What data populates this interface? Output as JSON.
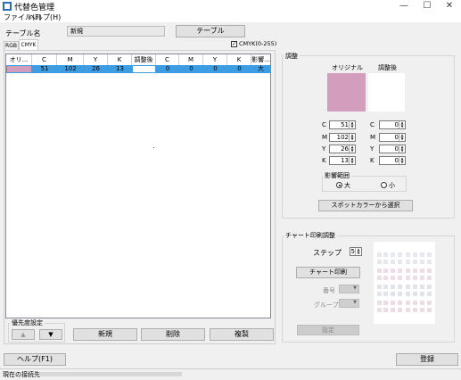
{
  "window": {
    "title": "代替色管理"
  },
  "menu": {
    "file": "ファイル(F)",
    "help": "ヘルプ(H)"
  },
  "header": {
    "table_name_label": "テーブル名",
    "table_name_value": "新規",
    "table_button": "テーブル"
  },
  "tabs": [
    "RGB",
    "CMYK"
  ],
  "cmyk_range_label": "CMYK(0-255)",
  "table": {
    "columns": [
      "オリ...",
      "C",
      "M",
      "Y",
      "K",
      "調整後",
      "C",
      "M",
      "Y",
      "K",
      "影響..."
    ],
    "rows": [
      {
        "c1": "51",
        "m1": "102",
        "y1": "26",
        "k1": "13",
        "c2": "0",
        "m2": "0",
        "y2": "0",
        "k2": "0",
        "range": "大"
      }
    ],
    "original_swatch": "#d39ebd",
    "selected_row_color": "#3d9de2"
  },
  "priority": {
    "label": "優先度設定",
    "up": "▲",
    "down": "▼"
  },
  "actions": {
    "new": "新規",
    "delete": "削除",
    "copy": "複製"
  },
  "adjust": {
    "title": "調整",
    "original_label": "オリジナル",
    "adjusted_label": "調整後",
    "original_color": "#d39ebd",
    "adjusted_color": "#ffffff",
    "left": [
      {
        "label": "C",
        "value": "51"
      },
      {
        "label": "M",
        "value": "102"
      },
      {
        "label": "Y",
        "value": "26"
      },
      {
        "label": "K",
        "value": "13"
      }
    ],
    "right": [
      {
        "label": "C",
        "value": "0"
      },
      {
        "label": "M",
        "value": "0"
      },
      {
        "label": "Y",
        "value": "0"
      },
      {
        "label": "K",
        "value": "0"
      }
    ],
    "range_title": "影響範囲",
    "range_large": "大",
    "range_small": "小",
    "spot_button": "スポットカラーから選択"
  },
  "chart": {
    "title": "チャート印刷調整",
    "step_label": "ステップ",
    "step_value": "5",
    "print_button": "チャート印刷",
    "number_label": "番号",
    "group_label": "グループ",
    "set_button": "設定"
  },
  "footer": {
    "help_button": "ヘルプ(F1)",
    "register_button": "登録"
  },
  "status": {
    "current_label": "現在の接続先"
  }
}
